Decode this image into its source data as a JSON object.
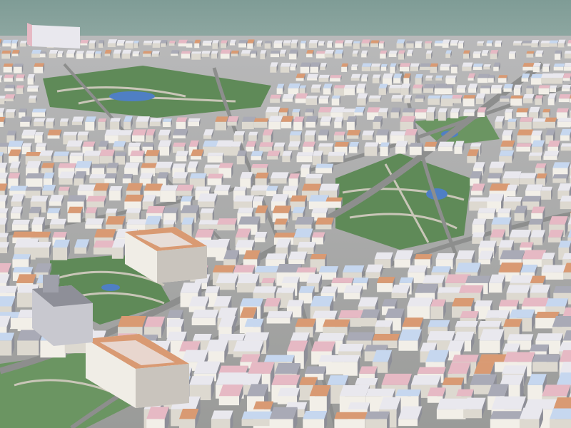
{
  "scene": {
    "type": "3d-city-aerial-view",
    "colors": {
      "sky": "#7f9c96",
      "horizon_haze": "#8fa8a2",
      "ground": "#a7a8a6",
      "park_grass": "#5f8a58",
      "park_grass_light": "#7ea275",
      "park_path": "#c9c6b8",
      "water": "#4f7fc4",
      "road": "#8d8e8d",
      "roof_white": "#e9e8ee",
      "roof_grey": "#a9aab6",
      "roof_pink": "#e6b9c4",
      "roof_terracotta": "#d99a73",
      "roof_blue": "#c6d7ef",
      "wall_shadow": "#8e8f98",
      "wall_light": "#f2efe8"
    },
    "features": {
      "parks": 5,
      "ponds": 4
    }
  }
}
